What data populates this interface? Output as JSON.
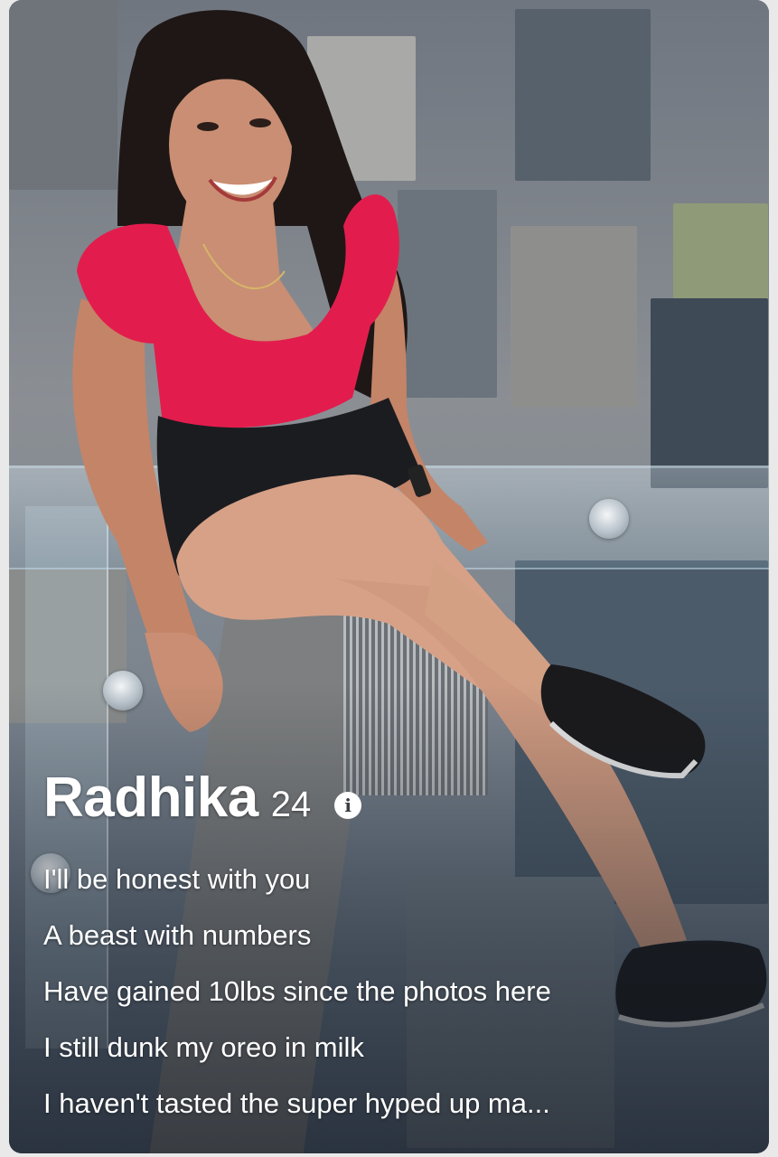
{
  "profile": {
    "name": "Radhika",
    "age": "24",
    "info_icon": "info-icon"
  },
  "bio": {
    "lines": [
      "I'll be honest with you",
      "A beast with numbers",
      "Have gained 10lbs since the photos here",
      "I still dunk my oreo in milk",
      "I haven't tasted the super hyped up ma..."
    ]
  },
  "colors": {
    "background": "#e9e9ea",
    "text": "#ffffff",
    "shirt": "#e21d4d",
    "shorts": "#1b1c20"
  }
}
